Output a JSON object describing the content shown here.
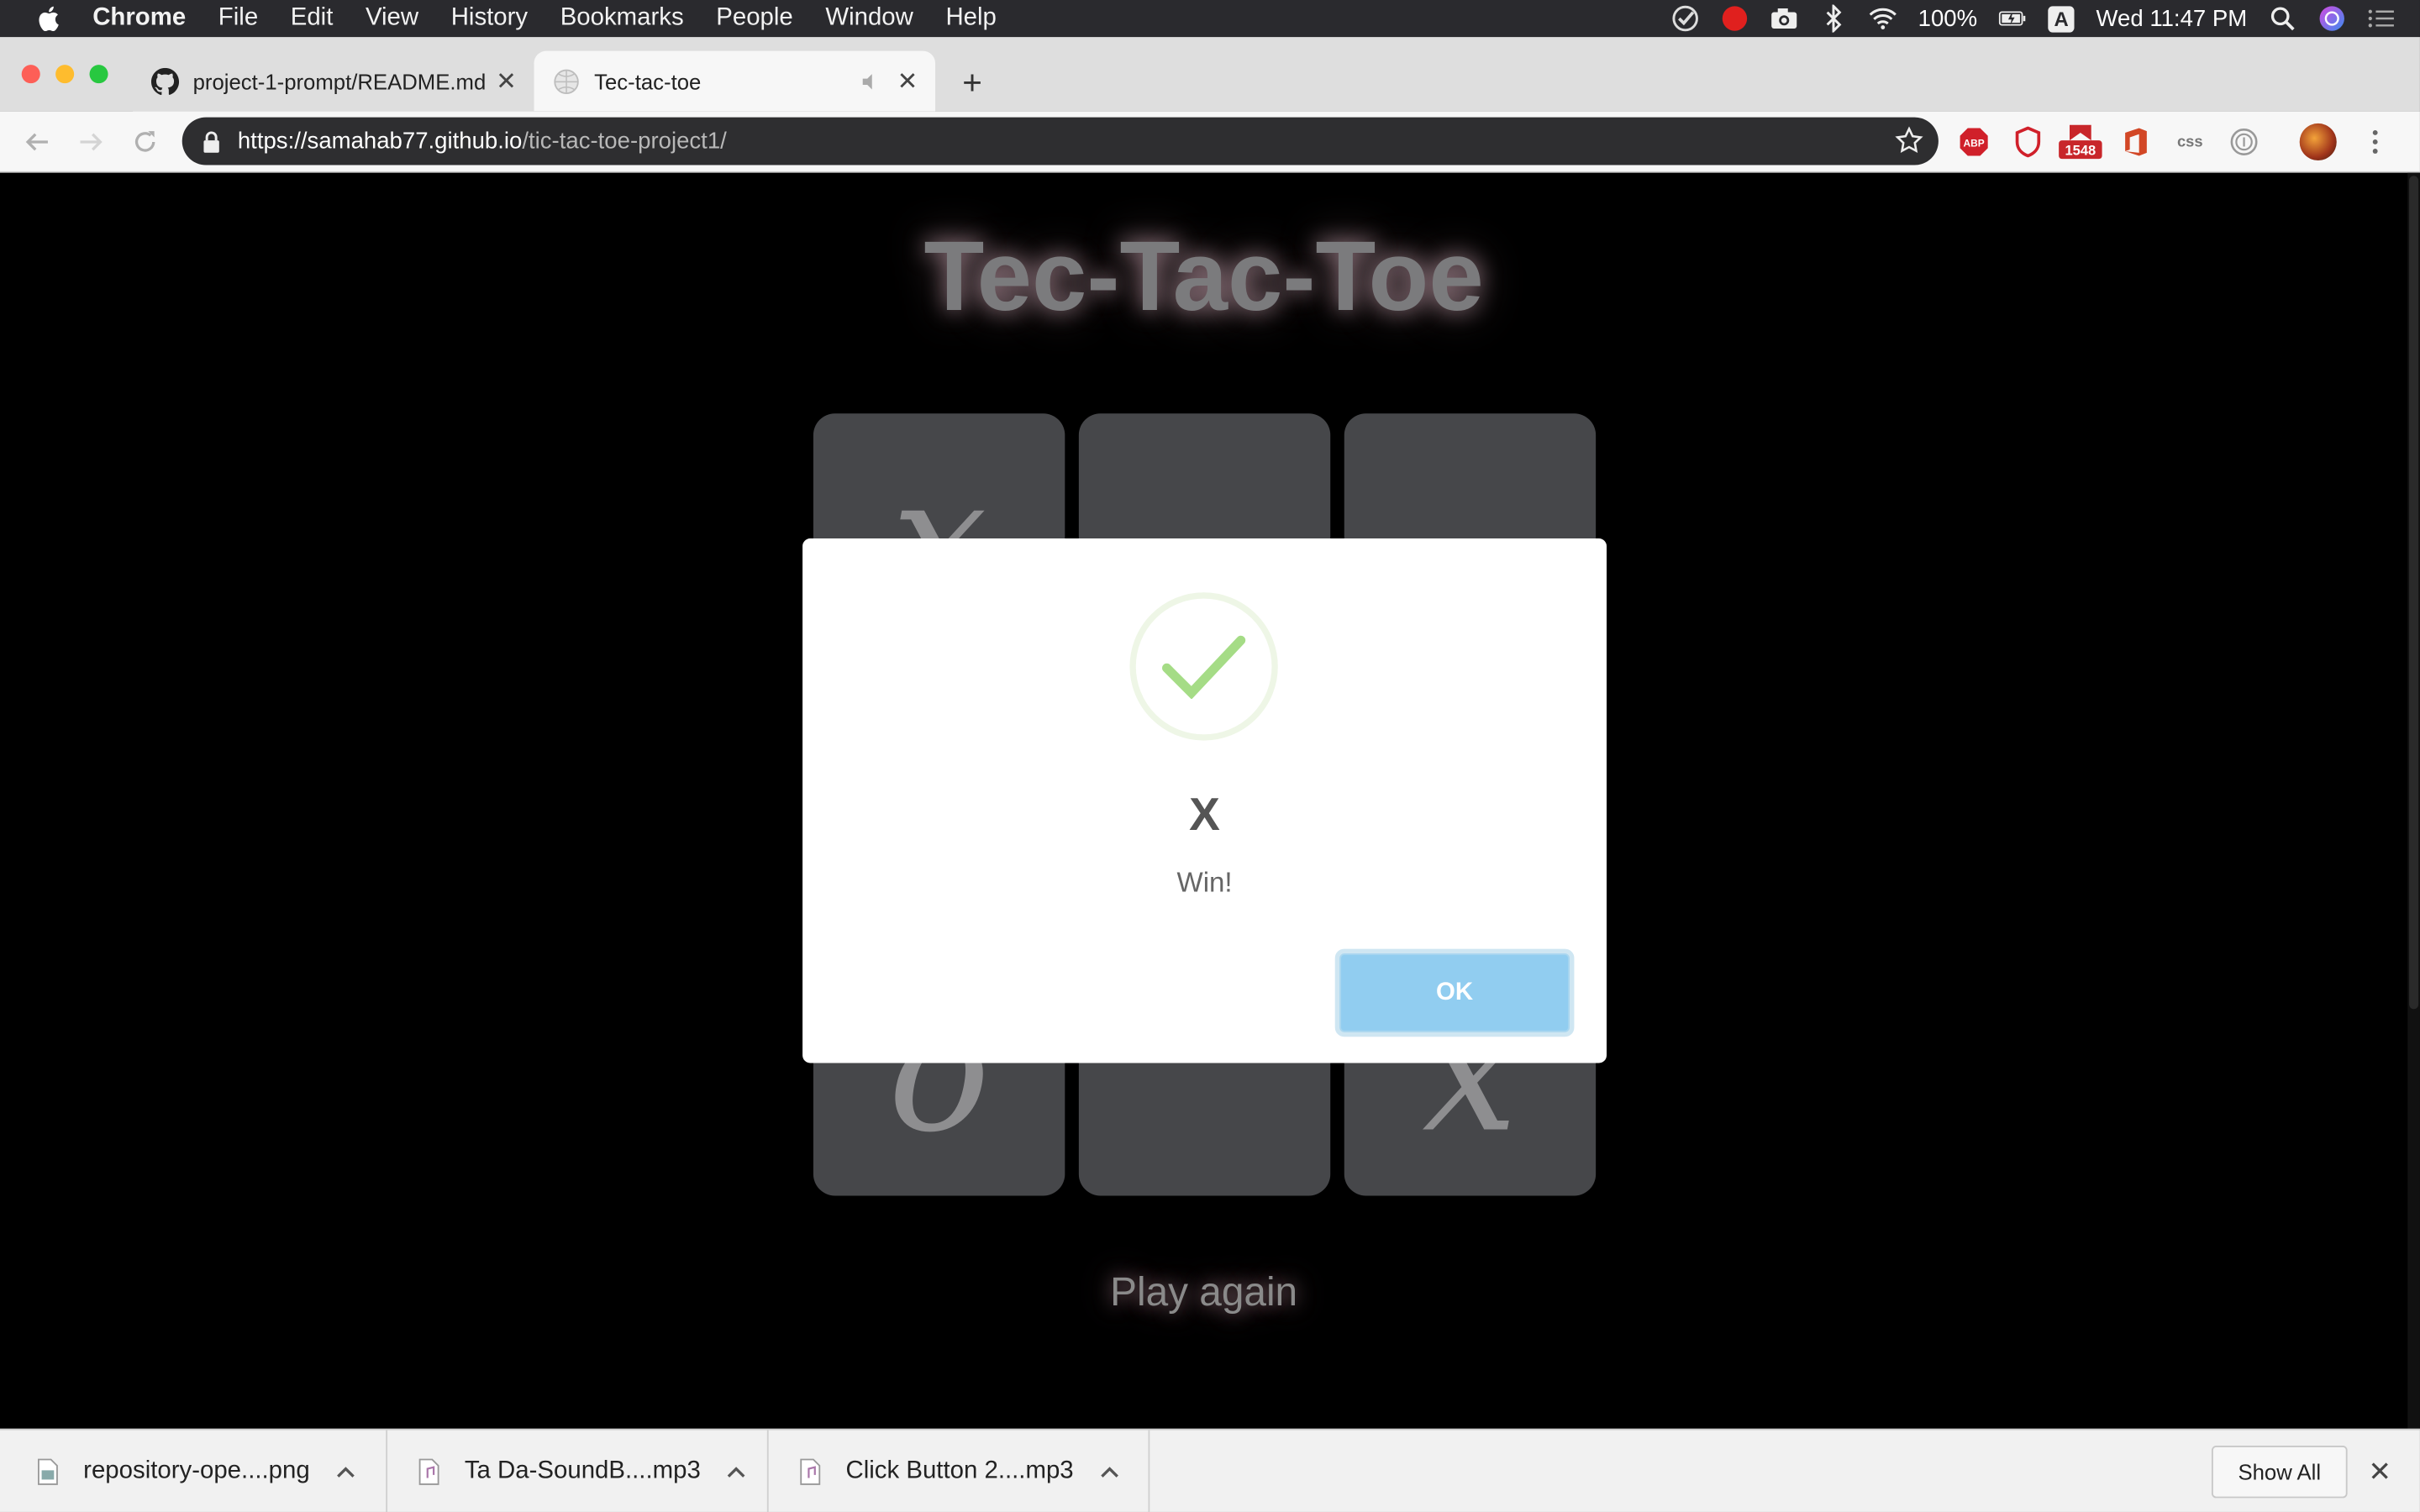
{
  "menubar": {
    "app": "Chrome",
    "items": [
      "File",
      "Edit",
      "View",
      "History",
      "Bookmarks",
      "People",
      "Window",
      "Help"
    ],
    "battery": "100%",
    "input_source": "A",
    "clock": "Wed 11:47 PM"
  },
  "tabs": [
    {
      "title": "project-1-prompt/README.md",
      "favicon": "github-icon"
    },
    {
      "title": "Tec-tac-toe",
      "favicon": "globe-icon"
    }
  ],
  "omnibox": {
    "url_host": "https://samahab77.github.io",
    "url_path": "/tic-tac-toe-project1/"
  },
  "extensions": {
    "abp": "ABP",
    "gmail_badge": "1548",
    "css": "css"
  },
  "game": {
    "title": "Tec-Tac-Toe",
    "cells": [
      "x",
      "",
      "",
      "",
      "",
      "",
      "o",
      "",
      "x"
    ],
    "play_again": "Play again"
  },
  "modal": {
    "title": "X",
    "text": "Win!",
    "ok_label": "OK",
    "accent": "#91cdf0",
    "check_color": "#a5dc86"
  },
  "downloads": {
    "items": [
      {
        "name": "repository-ope....png"
      },
      {
        "name": "Ta Da-SoundB....mp3"
      },
      {
        "name": "Click Button 2....mp3"
      }
    ],
    "show_all": "Show All"
  }
}
